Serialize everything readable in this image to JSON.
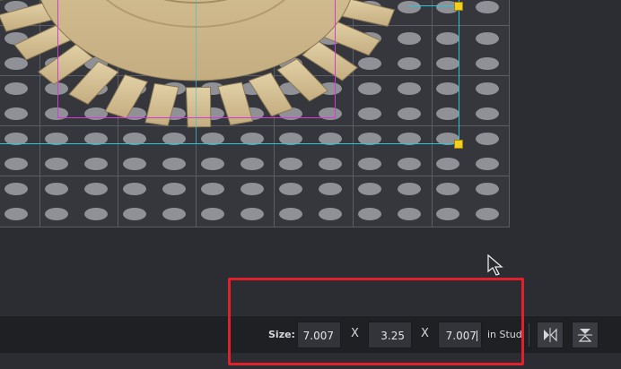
{
  "toolbar": {
    "size_label": "Size:",
    "width_value": "7.007",
    "height_value": "3.25",
    "depth_value": "7.007",
    "separator_1": "X",
    "separator_2": "X",
    "unit_label": "in Stud",
    "mirror_x_icon": "flip-horizontal-icon",
    "mirror_y_icon": "flip-vertical-icon"
  },
  "colors": {
    "viewport_bg": "#2b2d33",
    "baseplate": "#35373c",
    "stud": "#8f9196",
    "selection_line": "#29c5d8",
    "bounding_box": "#d43ad8",
    "handle": "#f1cf1c",
    "gear": "#d8c49a",
    "highlight": "#e0202a"
  }
}
